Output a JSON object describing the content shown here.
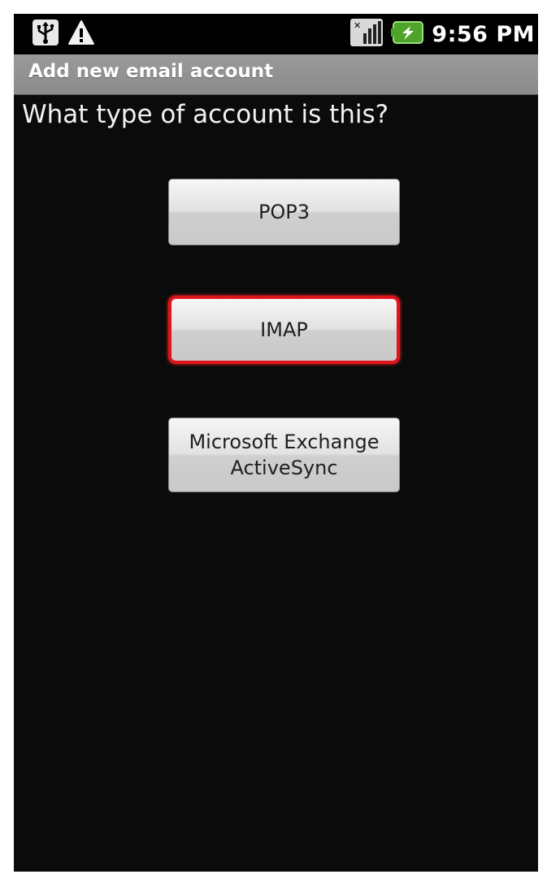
{
  "status_bar": {
    "left_icons": [
      "usb-icon",
      "warning-icon"
    ],
    "right_icons": [
      "signal-icon",
      "battery-charging-icon"
    ],
    "time": "9:56 PM"
  },
  "title_bar": {
    "title": "Add new email account"
  },
  "main": {
    "question": "What type of account is this?",
    "buttons": [
      {
        "label": "POP3"
      },
      {
        "label": "IMAP",
        "highlighted": true
      },
      {
        "label": "Microsoft Exchange\nActiveSync"
      }
    ]
  },
  "colors": {
    "highlight": "#e0141c",
    "title_bar": "#929292",
    "battery": "#4ea32a"
  }
}
